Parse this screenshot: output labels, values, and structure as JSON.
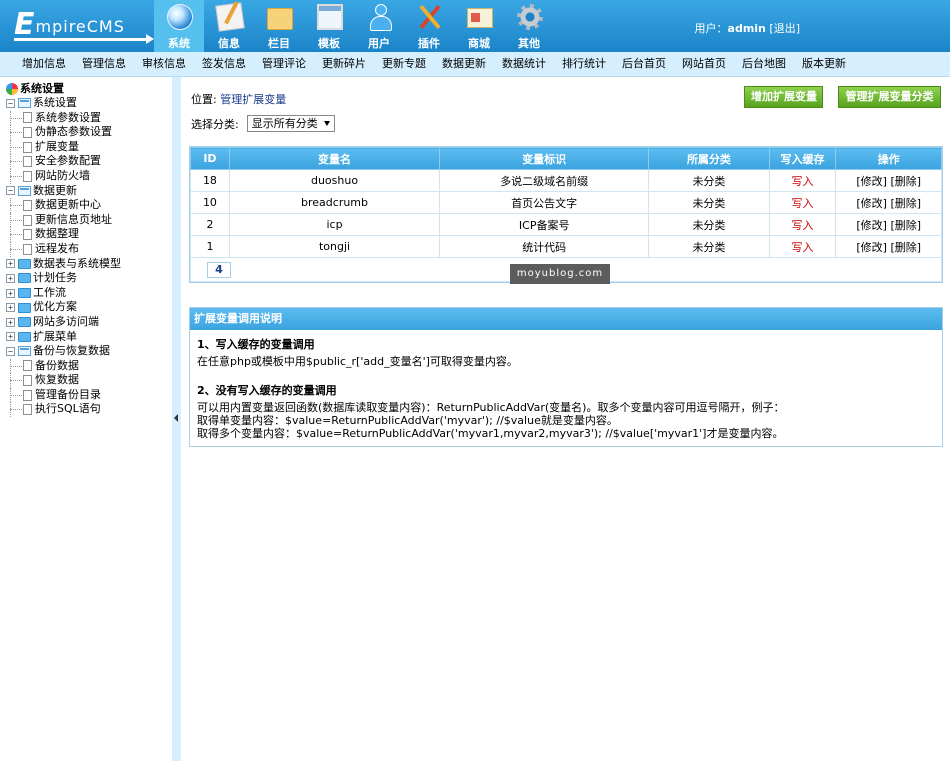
{
  "header": {
    "logo": "EmpireCMS",
    "nav": [
      {
        "label": "系统",
        "icon": "globe-icon",
        "active": true
      },
      {
        "label": "信息",
        "icon": "document-icon"
      },
      {
        "label": "栏目",
        "icon": "folder-icon"
      },
      {
        "label": "模板",
        "icon": "template-window-icon"
      },
      {
        "label": "用户",
        "icon": "user-icon"
      },
      {
        "label": "插件",
        "icon": "tools-icon"
      },
      {
        "label": "商城",
        "icon": "shop-card-icon"
      },
      {
        "label": "其他",
        "icon": "gear-icon"
      }
    ],
    "user_prefix": "用户：",
    "username": "admin",
    "logout": "[退出]"
  },
  "submenu": [
    "增加信息",
    "管理信息",
    "审核信息",
    "签发信息",
    "管理评论",
    "更新碎片",
    "更新专题",
    "数据更新",
    "数据统计",
    "排行统计",
    "后台首页",
    "网站首页",
    "后台地图",
    "版本更新"
  ],
  "sidebar": {
    "root": "系统设置",
    "groups": [
      {
        "label": "系统设置",
        "open": true,
        "items": [
          "系统参数设置",
          "伪静态参数设置",
          "扩展变量",
          "安全参数配置",
          "网站防火墙"
        ]
      },
      {
        "label": "数据更新",
        "open": true,
        "items": [
          "数据更新中心",
          "更新信息页地址",
          "数据整理",
          "远程发布"
        ]
      },
      {
        "label": "数据表与系统模型",
        "open": false,
        "items": []
      },
      {
        "label": "计划任务",
        "open": false,
        "items": []
      },
      {
        "label": "工作流",
        "open": false,
        "items": []
      },
      {
        "label": "优化方案",
        "open": false,
        "items": []
      },
      {
        "label": "网站多访问端",
        "open": false,
        "items": []
      },
      {
        "label": "扩展菜单",
        "open": false,
        "items": []
      },
      {
        "label": "备份与恢复数据",
        "open": true,
        "items": [
          "备份数据",
          "恢复数据",
          "管理备份目录",
          "执行SQL语句"
        ]
      }
    ]
  },
  "main": {
    "crumb_prefix": "位置: ",
    "crumb_link": "管理扩展变量",
    "btn_add": "增加扩展变量",
    "btn_manage_cat": "管理扩展变量分类",
    "filter_label": "选择分类:",
    "filter_value": "显示所有分类",
    "table": {
      "headers": [
        "ID",
        "变量名",
        "变量标识",
        "所属分类",
        "写入缓存",
        "操作"
      ],
      "rows": [
        {
          "id": "18",
          "name": "duoshuo",
          "label": "多说二级域名前缀",
          "category": "未分类",
          "write": "写入",
          "edit": "[修改]",
          "del": "[删除]"
        },
        {
          "id": "10",
          "name": "breadcrumb",
          "label": "首页公告文字",
          "category": "未分类",
          "write": "写入",
          "edit": "[修改]",
          "del": "[删除]"
        },
        {
          "id": "2",
          "name": "icp",
          "label": "ICP备案号",
          "category": "未分类",
          "write": "写入",
          "edit": "[修改]",
          "del": "[删除]"
        },
        {
          "id": "1",
          "name": "tongji",
          "label": "统计代码",
          "category": "未分类",
          "write": "写入",
          "edit": "[修改]",
          "del": "[删除]"
        }
      ],
      "total": "4"
    },
    "watermark": "moyublog.com",
    "help": {
      "title": "扩展变量调用说明",
      "h1": "1、写入缓存的变量调用",
      "p1": "在任意php或模板中用$public_r['add_变量名']可取得变量内容。",
      "h2": "2、没有写入缓存的变量调用",
      "p2": "可以用内置变量返回函数(数据库读取变量内容)：ReturnPublicAddVar(变量名)。取多个变量内容可用逗号隔开，例子：",
      "p3": "取得单变量内容：$value=ReturnPublicAddVar('myvar'); //$value就是变量内容。",
      "p4": "取得多个变量内容：$value=ReturnPublicAddVar('myvar1,myvar2,myvar3'); //$value['myvar1']才是变量内容。"
    }
  }
}
